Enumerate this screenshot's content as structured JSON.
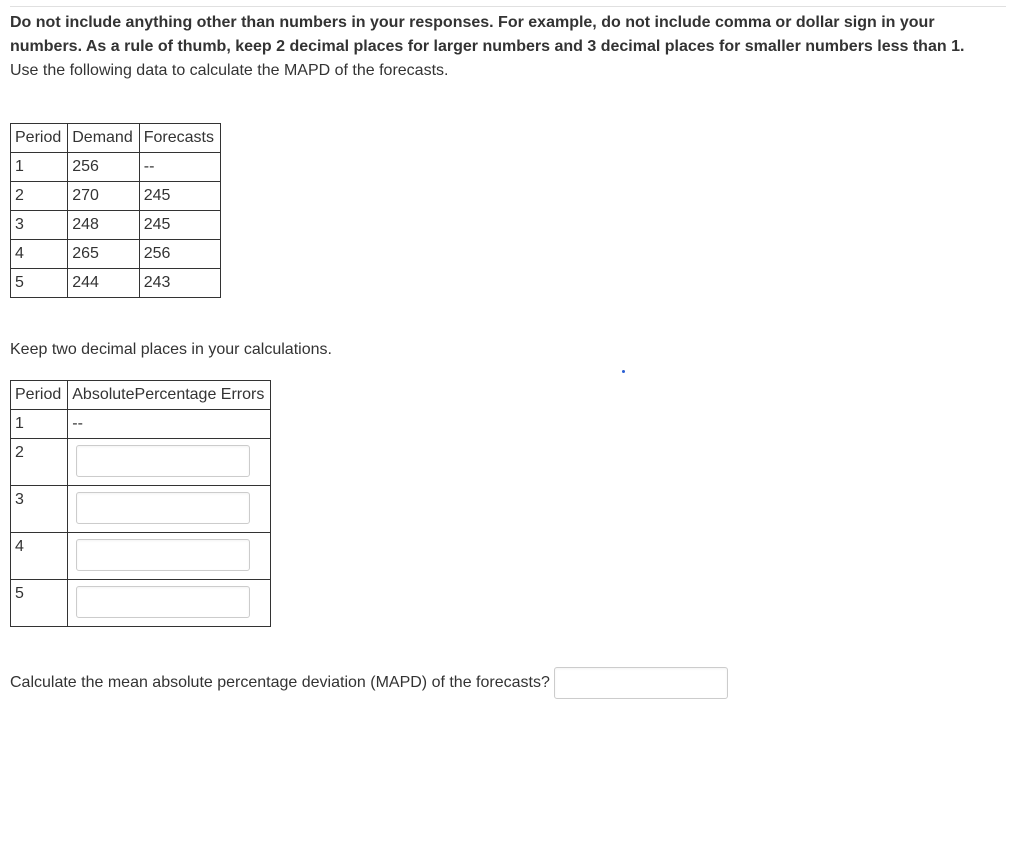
{
  "instructions": {
    "bold_text": "Do not include anything other than numbers in your responses. For example, do not include comma or dollar sign in your numbers. As a rule of thumb, keep 2 decimal places for larger numbers and 3 decimal places for smaller numbers less than 1.",
    "normal_text": "Use the following data to calculate the MAPD of the forecasts."
  },
  "data_table": {
    "headers": {
      "c0": "Period",
      "c1": "Demand",
      "c2": "Forecasts"
    },
    "rows": [
      {
        "c0": "1",
        "c1": "256",
        "c2": "--"
      },
      {
        "c0": "2",
        "c1": "270",
        "c2": "245"
      },
      {
        "c0": "3",
        "c1": "248",
        "c2": "245"
      },
      {
        "c0": "4",
        "c1": "265",
        "c2": "256"
      },
      {
        "c0": "5",
        "c1": "244",
        "c2": "243"
      }
    ]
  },
  "mid_instruction": "Keep two decimal places in your calculations.",
  "input_table": {
    "headers": {
      "c0": "Period",
      "c1": "AbsolutePercentage Errors"
    },
    "rows": [
      {
        "period": "1",
        "value": "--",
        "has_input": false
      },
      {
        "period": "2",
        "value": "",
        "has_input": true
      },
      {
        "period": "3",
        "value": "",
        "has_input": true
      },
      {
        "period": "4",
        "value": "",
        "has_input": true
      },
      {
        "period": "5",
        "value": "",
        "has_input": true
      }
    ]
  },
  "final_question": "Calculate the mean absolute percentage deviation (MAPD) of the forecasts?"
}
